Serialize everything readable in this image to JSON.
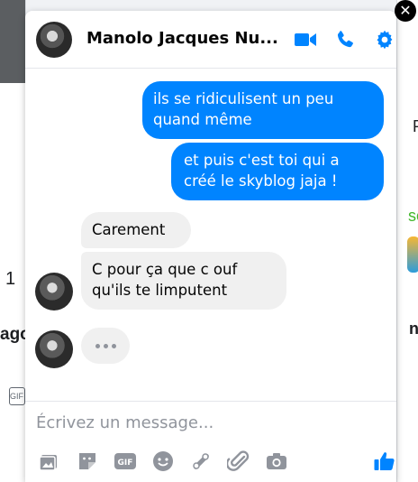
{
  "background": {
    "left_number": "1",
    "left_fragment": "ago",
    "left_gif": "GIF",
    "right_letter_p": "P",
    "right_letter_se": "se",
    "right_letter_n": "n"
  },
  "chat": {
    "title": "Manolo Jacques Nu...",
    "close_glyph": "✕",
    "messages_out": [
      {
        "text_line1": "ils se ridiculisent un peu",
        "text_line2": "quand même"
      },
      {
        "text_line1": "et puis c'est toi qui a",
        "text_line2": "créé le skyblog jaja !"
      }
    ],
    "messages_in": [
      {
        "text_line1": "Carement"
      },
      {
        "text_line1": "C pour ça que c ouf",
        "text_line2": "qu'ils te limputent"
      }
    ],
    "composer": {
      "placeholder": "Écrivez un message..."
    },
    "colors": {
      "accent": "#0084ff",
      "incoming_bubble": "#f0f0f0",
      "icon_gray": "#90949c"
    },
    "header_icons": [
      "video-call-icon",
      "phone-icon",
      "gear-icon"
    ],
    "toolbar_icons": [
      "photo-icon",
      "sticker-icon",
      "gif-icon",
      "emoji-icon",
      "games-icon",
      "attachment-icon",
      "camera-icon",
      "thumbs-up-icon"
    ],
    "gif_label": "GIF"
  }
}
